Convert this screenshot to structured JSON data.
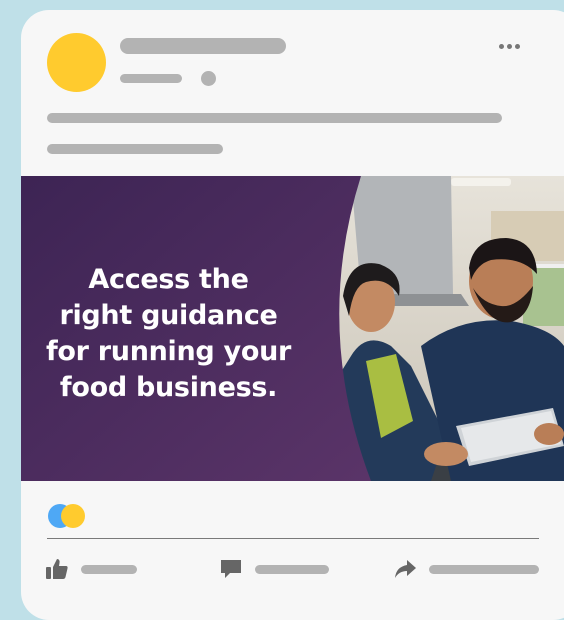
{
  "post": {
    "headline_lines": [
      "Access the",
      "right guidance",
      "for running your",
      "food business."
    ]
  },
  "colors": {
    "background": "#bfe0e8",
    "card": "#f7f7f7",
    "avatar": "#ffcb2e",
    "placeholder": "#b3b3b3",
    "banner_purple": "#4a2a5e",
    "reaction_like": "#4ea8f5",
    "reaction_love": "#ffcb2e",
    "icon": "#666666"
  },
  "icons": {
    "more": "more-horizontal-icon",
    "like": "thumbs-up-icon",
    "comment": "comment-icon",
    "share": "share-icon"
  },
  "reaction_names": [
    "like-reaction",
    "favorite-reaction"
  ]
}
